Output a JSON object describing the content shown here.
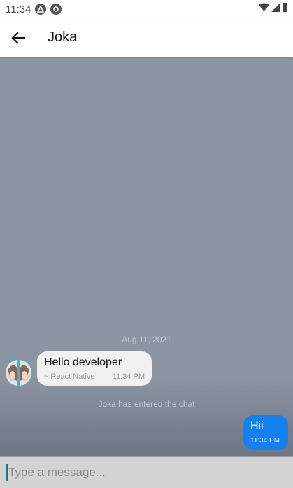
{
  "status_bar": {
    "time": "11:34"
  },
  "header": {
    "title": "Joka"
  },
  "chat": {
    "date_separator": "Aug 11, 2021",
    "incoming": {
      "text": "Hello developer",
      "sender": "~ React Native",
      "time": "11:34 PM"
    },
    "system_message": "Joka has entered the chat",
    "outgoing": {
      "text": "Hii",
      "time": "11:34 PM"
    }
  },
  "composer": {
    "placeholder": "Type a message..."
  },
  "colors": {
    "outgoing_bubble": "#1580f0",
    "chat_background": "#8b94a3",
    "incoming_bubble": "#f0f0f0"
  }
}
